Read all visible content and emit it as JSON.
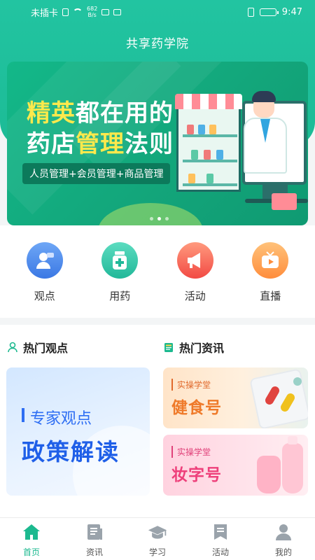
{
  "status_bar": {
    "carrier": "未插卡",
    "speed_value": "682",
    "speed_unit": "B/s",
    "time": "9:47",
    "battery_level": 0.9
  },
  "app": {
    "title": "共享药学院"
  },
  "banner": {
    "title_line1_highlight": "精英",
    "title_line1_rest": "都在用的",
    "title_line2_a": "药店",
    "title_line2_highlight": "管理",
    "title_line2_b": "法则",
    "subtitle": "人员管理+会员管理+商品管理",
    "dots": 3,
    "active_dot": 1
  },
  "quick_nav": [
    {
      "label": "观点",
      "icon": "expert-user-icon",
      "color": "#3b78e4"
    },
    {
      "label": "用药",
      "icon": "medicine-bottle-icon",
      "color": "#21b899"
    },
    {
      "label": "活动",
      "icon": "megaphone-icon",
      "color": "#f24a44"
    },
    {
      "label": "直播",
      "icon": "tv-play-icon",
      "color": "#ff8d3c"
    }
  ],
  "sections": {
    "hot_views": {
      "title": "热门观点",
      "icon": "person-outline-icon"
    },
    "hot_news": {
      "title": "热门资讯",
      "icon": "news-book-icon"
    }
  },
  "cards": {
    "expert": {
      "sub": "专家观点",
      "main": "政策解读"
    },
    "food": {
      "tag": "实操学堂",
      "title": "健食号"
    },
    "beauty": {
      "tag": "实操学堂",
      "title": "妆字号"
    }
  },
  "tabbar": [
    {
      "label": "首页",
      "icon": "home-icon",
      "active": true
    },
    {
      "label": "资讯",
      "icon": "document-icon",
      "active": false
    },
    {
      "label": "学习",
      "icon": "graduation-cap-icon",
      "active": false
    },
    {
      "label": "活动",
      "icon": "bookmark-icon",
      "active": false
    },
    {
      "label": "我的",
      "icon": "user-profile-icon",
      "active": false
    }
  ],
  "colors": {
    "brand": "#1cb98f",
    "inactive": "#9aa3ab"
  }
}
